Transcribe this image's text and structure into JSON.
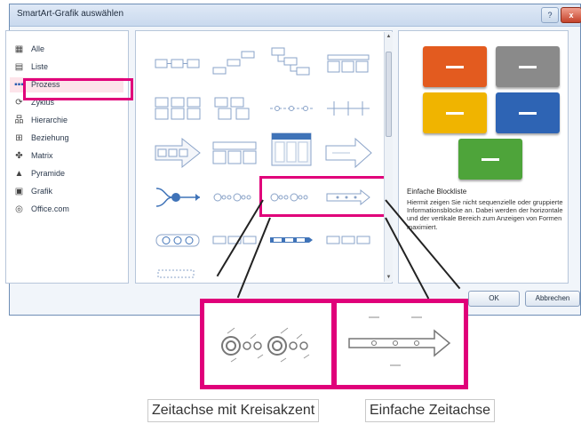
{
  "dialog": {
    "title": "SmartArt-Grafik auswählen",
    "help_label": "?",
    "close_label": "x",
    "categories": [
      {
        "label": "Alle",
        "icon": "all-icon"
      },
      {
        "label": "Liste",
        "icon": "list-icon"
      },
      {
        "label": "Prozess",
        "icon": "process-icon"
      },
      {
        "label": "Zyklus",
        "icon": "cycle-icon"
      },
      {
        "label": "Hierarchie",
        "icon": "hierarchy-icon"
      },
      {
        "label": "Beziehung",
        "icon": "relationship-icon"
      },
      {
        "label": "Matrix",
        "icon": "matrix-icon"
      },
      {
        "label": "Pyramide",
        "icon": "pyramid-icon"
      },
      {
        "label": "Grafik",
        "icon": "picture-icon"
      },
      {
        "label": "Office.com",
        "icon": "office-com-icon"
      }
    ],
    "selected_category": "Prozess",
    "preview": {
      "title": "Einfache Blockliste",
      "description": "Hiermit zeigen Sie nicht sequenzielle oder gruppierte Informationsblöcke an. Dabei werden der horizontale und der vertikale Bereich zum Anzeigen von Formen maximiert.",
      "tile_colors": [
        "#e35b1f",
        "#8a8a8a",
        "#f0b400",
        "#2e64b4",
        "#4ea43a"
      ]
    },
    "ok_label": "OK",
    "cancel_label": "Abbrechen"
  },
  "zoom": {
    "left_label": "Zeitachse mit Kreisakzent",
    "right_label": "Einfache Zeitachse"
  },
  "colors": {
    "highlight": "#e0007a"
  }
}
